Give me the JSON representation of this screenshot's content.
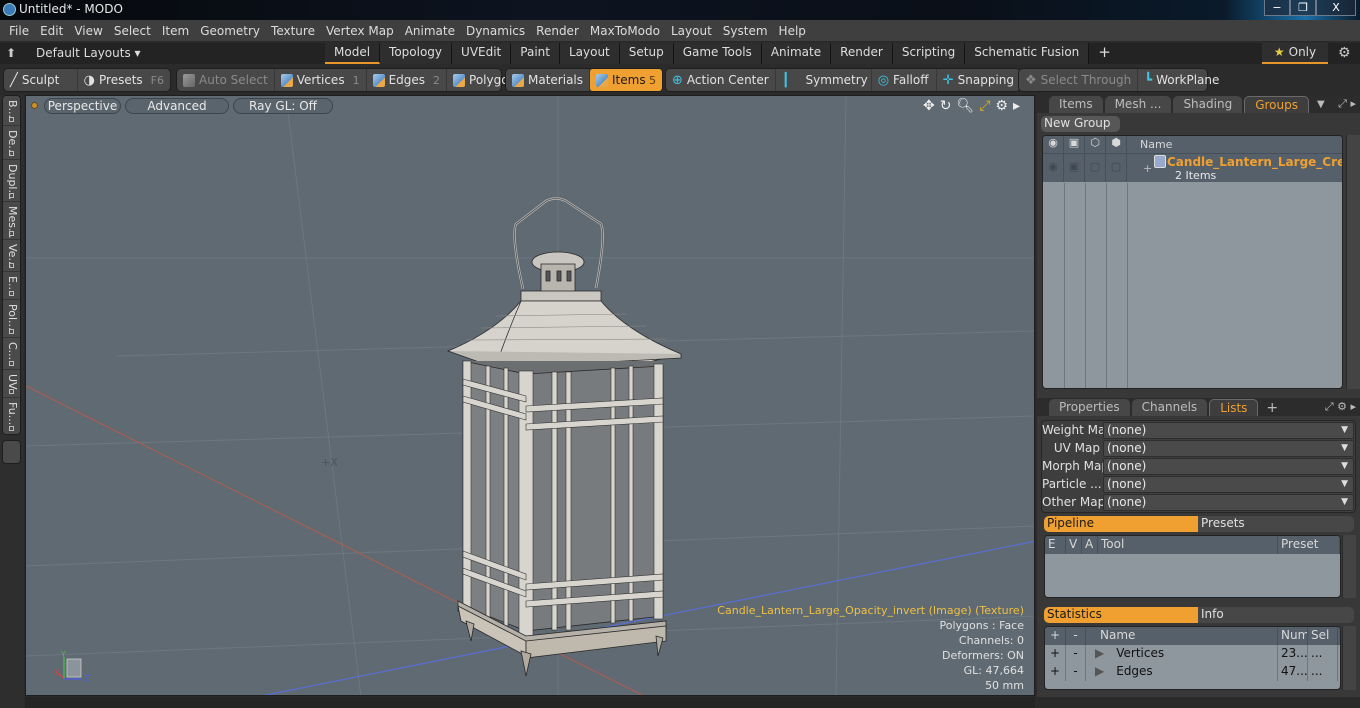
{
  "window": {
    "title": "Untitled* - MODO",
    "controls": {
      "minimize": "−",
      "restore": "❐",
      "close": "X"
    }
  },
  "menubar": [
    "File",
    "Edit",
    "View",
    "Select",
    "Item",
    "Geometry",
    "Texture",
    "Vertex Map",
    "Animate",
    "Dynamics",
    "Render",
    "MaxToModo",
    "Layout",
    "System",
    "Help"
  ],
  "layoutbar": {
    "home_icon": "⬆",
    "layout_dropdown": "Default Layouts ▾",
    "tabs": [
      "Model",
      "Topology",
      "UVEdit",
      "Paint",
      "Layout",
      "Setup",
      "Game Tools",
      "Animate",
      "Render",
      "Scripting",
      "Schematic Fusion"
    ],
    "active_tab": "Model",
    "add_tab": "+",
    "only_label": "Only",
    "star": "★",
    "gear": "⚙"
  },
  "toolbar": {
    "sculpt": "Sculpt",
    "presets": "Presets",
    "presets_key": "F6",
    "auto_select": "Auto Select",
    "vertices": "Vertices",
    "vertices_key": "1",
    "edges": "Edges",
    "edges_key": "2",
    "polygons": "Polygons",
    "materials": "Materials",
    "items": "Items",
    "items_key": "5",
    "action_center": "Action Center",
    "symmetry": "Symmetry",
    "falloff": "Falloff",
    "snapping": "Snapping",
    "select_through": "Select Through",
    "workplane": "WorkPlane",
    "active_mode": "Items"
  },
  "left_tabs": [
    "B...",
    "De...",
    "Dupl...",
    "Mes...",
    "Ve...",
    "E...",
    "Pol...",
    "C...",
    "UV",
    "Fu..."
  ],
  "viewport": {
    "view_mode": "Perspective",
    "shading": "Advanced",
    "raygl": "Ray GL: Off",
    "info": {
      "texture": "Candle_Lantern_Large_Opacity_invert (Image) (Texture)",
      "polygons": "Polygons : Face",
      "channels": "Channels: 0",
      "deformers": "Deformers: ON",
      "gl": "GL: 47,664",
      "scale": "50 mm"
    },
    "gizmo_labels": {
      "x": "X",
      "y": "Y",
      "z": "Z"
    }
  },
  "groups_panel": {
    "tabs": [
      "Items",
      "Mesh ...",
      "Shading",
      "Groups"
    ],
    "active_tab": "Groups",
    "new_group": "New Group",
    "column_name": "Name",
    "rows": [
      {
        "name": "Candle_Lantern_Large_Crea ...",
        "count": "2 Items"
      }
    ]
  },
  "properties_panel": {
    "tabs": [
      "Properties",
      "Channels",
      "Lists"
    ],
    "active_tab": "Lists",
    "add_tab": "+",
    "lists": [
      {
        "label": "Weight Map",
        "value": "(none)"
      },
      {
        "label": "UV Map",
        "value": "(none)"
      },
      {
        "label": "Morph Map",
        "value": "(none)"
      },
      {
        "label": "Particle  ...",
        "value": "(none)"
      },
      {
        "label": "Other Map",
        "value": "(none)"
      }
    ],
    "pipeline_tabs": [
      "Pipeline",
      "Presets"
    ],
    "pipeline_columns": [
      "E",
      "V",
      "A",
      "Tool",
      "Preset"
    ],
    "stats_tabs": [
      "Statistics",
      "Info"
    ],
    "stats_columns": [
      "+",
      "-",
      "Name",
      "Num",
      "Sel"
    ],
    "stats_rows": [
      {
        "plus": "+",
        "minus": "-",
        "name": "Vertices",
        "num": "23...",
        "sel": "..."
      },
      {
        "plus": "+",
        "minus": "-",
        "name": "Edges",
        "num": "47...",
        "sel": "..."
      }
    ]
  },
  "colors": {
    "accent": "#f0a030",
    "viewport_bg": "#5f6a73",
    "item_highlight": "#f0a030",
    "texture_info": "#f0c040"
  }
}
